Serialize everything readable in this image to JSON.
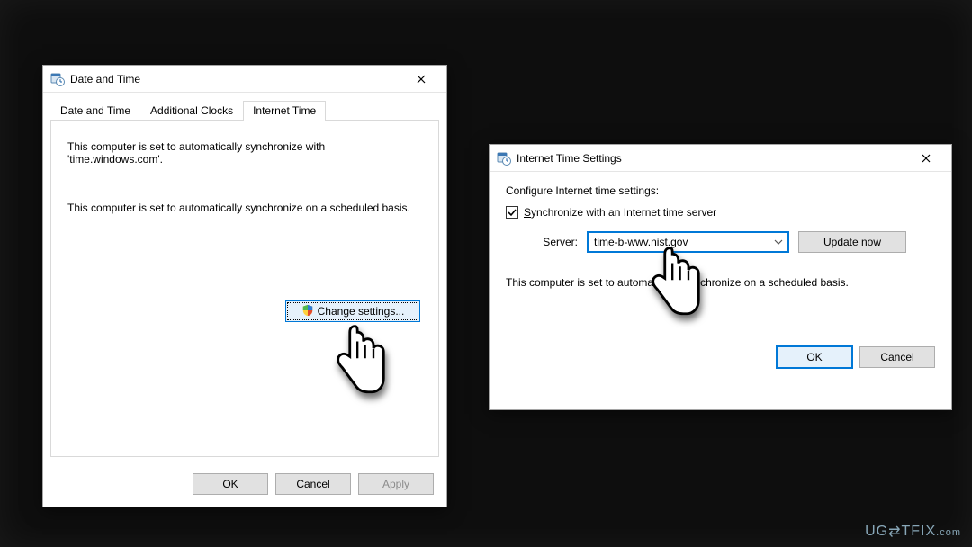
{
  "dialog1": {
    "title": "Date and Time",
    "tabs": [
      {
        "label": "Date and Time"
      },
      {
        "label": "Additional Clocks"
      },
      {
        "label": "Internet Time"
      }
    ],
    "active_tab": 2,
    "sync_text": "This computer is set to automatically synchronize with 'time.windows.com'.",
    "schedule_text": "This computer is set to automatically synchronize on a scheduled basis.",
    "change_settings_label": "Change settings...",
    "ok_label": "OK",
    "cancel_label": "Cancel",
    "apply_label": "Apply"
  },
  "dialog2": {
    "title": "Internet Time Settings",
    "heading": "Configure Internet time settings:",
    "checkbox_label": "Synchronize with an Internet time server",
    "checkbox_checked": true,
    "server_label": "Server:",
    "server_value": "time-b-wwv.nist.gov",
    "update_label": "Update now",
    "schedule_text": "This computer is set to automatically synchronize on a scheduled basis.",
    "ok_label": "OK",
    "cancel_label": "Cancel"
  },
  "watermark": "UGETFIX"
}
